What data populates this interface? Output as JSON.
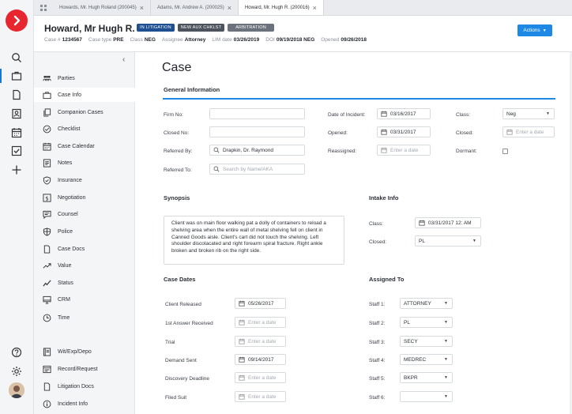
{
  "tabs": [
    {
      "label": "Howards, Mr. Hugh Roland (200045)",
      "active": false
    },
    {
      "label": "Adams, Mr. Andrew A. (200025)",
      "active": false
    },
    {
      "label": "Howard, Mr. Hugh R. (200016)",
      "active": true
    }
  ],
  "header": {
    "name": "Howard, Mr Hugh R.",
    "badges": [
      "IN LITIGATION",
      "NEW AUX CHKLST",
      "ARBITRATION"
    ],
    "meta": [
      {
        "label": "Case #",
        "value": "1234567"
      },
      {
        "label": "Case type",
        "value": "PRE"
      },
      {
        "label": "Class",
        "value": "NEG"
      },
      {
        "label": "Assignee",
        "value": "Attorney"
      },
      {
        "label": "LIM date",
        "value": "03/26/2019"
      },
      {
        "label": "DOI",
        "value": "09/19/2018 NEG"
      },
      {
        "label": "Opened",
        "value": "09/26/2018"
      }
    ],
    "actions_label": "Actions"
  },
  "sidebar": {
    "items": [
      {
        "label": "Parties",
        "icon": "people-icon"
      },
      {
        "label": "Case Info",
        "icon": "briefcase-icon",
        "active": true
      },
      {
        "label": "Companion Cases",
        "icon": "copy-icon"
      },
      {
        "label": "Checklist",
        "icon": "check-circle-icon"
      },
      {
        "label": "Case Calendar",
        "icon": "calendar-icon"
      },
      {
        "label": "Notes",
        "icon": "note-icon"
      },
      {
        "label": "Insurance",
        "icon": "shield-check-icon"
      },
      {
        "label": "Negotiation",
        "icon": "dollar-icon"
      },
      {
        "label": "Counsel",
        "icon": "chat-icon"
      },
      {
        "label": "Police",
        "icon": "badge-icon"
      },
      {
        "label": "Case Docs",
        "icon": "document-icon"
      },
      {
        "label": "Value",
        "icon": "trend-icon"
      },
      {
        "label": "Status",
        "icon": "pulse-icon"
      },
      {
        "label": "CRM",
        "icon": "monitor-icon"
      },
      {
        "label": "Time",
        "icon": "clock-icon"
      },
      {
        "label": "Wit/Exp/Depo",
        "icon": "book-icon"
      },
      {
        "label": "Record/Request",
        "icon": "window-icon"
      },
      {
        "label": "Litigation Docs",
        "icon": "document-icon"
      },
      {
        "label": "Incident Info",
        "icon": "info-icon"
      }
    ]
  },
  "main": {
    "title": "Case",
    "general_info": {
      "title": "General Information",
      "firm_no": {
        "label": "Firm No:",
        "value": ""
      },
      "closed_no": {
        "label": "Closed No:",
        "value": ""
      },
      "referred_by": {
        "label": "Referred By:",
        "value": "Drapkin, Dr. Raymond"
      },
      "referred_to": {
        "label": "Referred To:",
        "placeholder": "Search by Name/AKA"
      },
      "date_of_incident": {
        "label": "Date of Incident:",
        "value": "03/16/2017"
      },
      "opened": {
        "label": "Opened:",
        "value": "03/31/2017"
      },
      "reassigned": {
        "label": "Reassigned:",
        "placeholder": "Enter a date"
      },
      "class": {
        "label": "Class:",
        "value": "Neg"
      },
      "closed": {
        "label": "Closed:",
        "placeholder": "Enter a date"
      },
      "dormant": {
        "label": "Dormant:"
      }
    },
    "synopsis": {
      "title": "Synopsis",
      "text": "Client was on main floor walking pat a dolly of containers to reload a shelving area when the entire wall of metal shelving fell on client in Canned Goods aisle. Client's cart did not touch the shelving. Left shoulder discolacated and right forearm spiral fracture. Right ankle broken and broken rib on the right side."
    },
    "intake": {
      "title": "Intake Info",
      "class": {
        "label": "Class:",
        "value": "03/31/2017 12: AM"
      },
      "closed": {
        "label": "Closed:",
        "value": "PL"
      }
    },
    "case_dates": {
      "title": "Case Dates",
      "rows": [
        {
          "label": "Client Released",
          "value": "05/26/2017"
        },
        {
          "label": "1st Answer Received",
          "placeholder": "Enter a date"
        },
        {
          "label": "Trial",
          "placeholder": "Enter a date"
        },
        {
          "label": "Demand Sent",
          "value": "09/14/2017"
        },
        {
          "label": "Discovery Deadline",
          "placeholder": "Enter a date"
        },
        {
          "label": "Filed Suit",
          "placeholder": "Enter a date"
        }
      ]
    },
    "assigned_to": {
      "title": "Assigned To",
      "rows": [
        {
          "label": "Staff 1:",
          "value": "ATTORNEY"
        },
        {
          "label": "Staff 2:",
          "value": "PL"
        },
        {
          "label": "Staff 3:",
          "value": "SECY"
        },
        {
          "label": "Staff 4:",
          "value": "MEDREC"
        },
        {
          "label": "Staff 5:",
          "value": "BKPR"
        },
        {
          "label": "Staff 6:",
          "value": ""
        }
      ]
    }
  }
}
